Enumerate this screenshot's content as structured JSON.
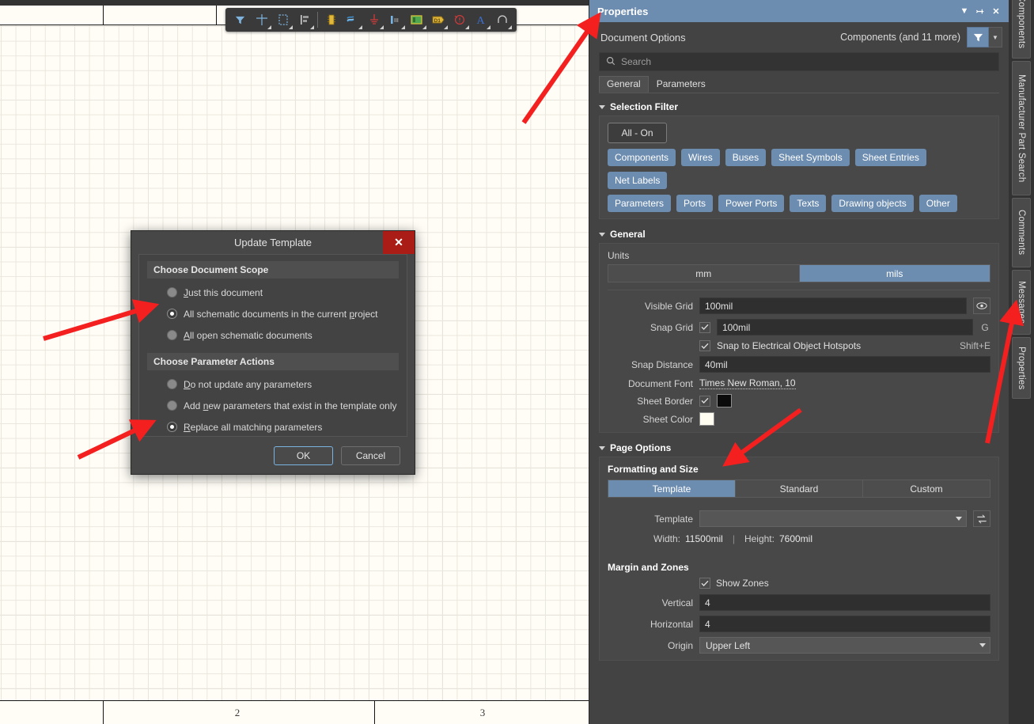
{
  "toolbar": {
    "buttons": [
      {
        "name": "filter-icon",
        "glyph": "filter"
      },
      {
        "name": "crosshair-icon",
        "glyph": "cross"
      },
      {
        "name": "selection-rect-icon",
        "glyph": "dashrect"
      },
      {
        "name": "align-icon",
        "glyph": "align"
      },
      {
        "name": "place-part-icon",
        "glyph": "ic"
      },
      {
        "name": "place-wire-icon",
        "glyph": "wire"
      },
      {
        "name": "place-gnd-icon",
        "glyph": "gnd"
      },
      {
        "name": "place-net-label-icon",
        "glyph": "netlabel"
      },
      {
        "name": "place-sheet-symbol-icon",
        "glyph": "sheet"
      },
      {
        "name": "place-port-icon",
        "glyph": "port"
      },
      {
        "name": "place-noerc-icon",
        "glyph": "noerc"
      },
      {
        "name": "place-text-icon",
        "glyph": "text"
      },
      {
        "name": "place-arc-icon",
        "glyph": "arc"
      }
    ]
  },
  "canvas": {
    "zone_labels": [
      "",
      "2",
      "3"
    ],
    "zone_dividers_x": [
      130,
      473
    ]
  },
  "dialog": {
    "title": "Update Template",
    "close_label": "✕",
    "scope": {
      "header": "Choose Document Scope",
      "options": [
        {
          "label": "Just this document",
          "underline": "J",
          "checked": false
        },
        {
          "label": "All schematic documents in the current project",
          "underline": "p",
          "checked": true
        },
        {
          "label": "All open schematic documents",
          "underline": "A",
          "checked": false
        }
      ]
    },
    "parameters": {
      "header": "Choose Parameter Actions",
      "options": [
        {
          "label": "Do not update any parameters",
          "underline": "D",
          "checked": false
        },
        {
          "label": "Add new parameters that exist in the template only",
          "underline": "n",
          "checked": false
        },
        {
          "label": "Replace all matching parameters",
          "underline": "R",
          "checked": true
        }
      ]
    },
    "ok_label": "OK",
    "cancel_label": "Cancel"
  },
  "panel": {
    "title": "Properties",
    "title_buttons": [
      "chevron-down",
      "pin",
      "close"
    ],
    "document_options_label": "Document Options",
    "filter_summary": "Components (and 11 more)",
    "search": {
      "placeholder": "Search",
      "value": ""
    },
    "tabs": [
      {
        "label": "General",
        "active": true
      },
      {
        "label": "Parameters",
        "active": false
      }
    ],
    "selection_filter": {
      "header": "Selection Filter",
      "all_on_label": "All - On",
      "chips_row1": [
        "Components",
        "Wires",
        "Buses",
        "Sheet Symbols",
        "Sheet Entries",
        "Net Labels"
      ],
      "chips_row2": [
        "Parameters",
        "Ports",
        "Power Ports",
        "Texts",
        "Drawing objects",
        "Other"
      ]
    },
    "general": {
      "header": "General",
      "units_label": "Units",
      "units_options": [
        {
          "label": "mm",
          "active": false
        },
        {
          "label": "mils",
          "active": true
        }
      ],
      "visible_grid_label": "Visible Grid",
      "visible_grid_value": "100mil",
      "snap_grid_label": "Snap Grid",
      "snap_grid_value": "100mil",
      "snap_grid_checked": true,
      "snap_grid_shortcut": "G",
      "snap_hotspots_label": "Snap to Electrical Object Hotspots",
      "snap_hotspots_checked": true,
      "snap_hotspots_shortcut": "Shift+E",
      "snap_distance_label": "Snap Distance",
      "snap_distance_value": "40mil",
      "document_font_label": "Document Font",
      "document_font_value": "Times New Roman, 10",
      "sheet_border_label": "Sheet Border",
      "sheet_border_checked": true,
      "sheet_border_color": "#0b0b0b",
      "sheet_color_label": "Sheet Color",
      "sheet_color_value": "#fffdf2"
    },
    "page_options": {
      "header": "Page Options",
      "formatting_label": "Formatting and Size",
      "format_options": [
        {
          "label": "Template",
          "active": true
        },
        {
          "label": "Standard",
          "active": false
        },
        {
          "label": "Custom",
          "active": false
        }
      ],
      "template_label": "Template",
      "template_value": "",
      "width_label": "Width:",
      "width_value": "11500mil",
      "height_label": "Height:",
      "height_value": "7600mil",
      "margin_header": "Margin and Zones",
      "show_zones_label": "Show Zones",
      "show_zones_checked": true,
      "vertical_label": "Vertical",
      "vertical_value": "4",
      "horizontal_label": "Horizontal",
      "horizontal_value": "4",
      "origin_label": "Origin",
      "origin_value": "Upper Left"
    }
  },
  "vertical_tabs": [
    {
      "label": "Components"
    },
    {
      "label": "Manufacturer Part Search"
    },
    {
      "label": "Comments"
    },
    {
      "label": "Messages"
    },
    {
      "label": "Properties"
    }
  ],
  "colors": {
    "accent": "#6c8cb0",
    "panel_bg": "#434343",
    "canvas_bg": "#fffdf6",
    "annotation": "#f42020",
    "close_red": "#a91d16"
  }
}
